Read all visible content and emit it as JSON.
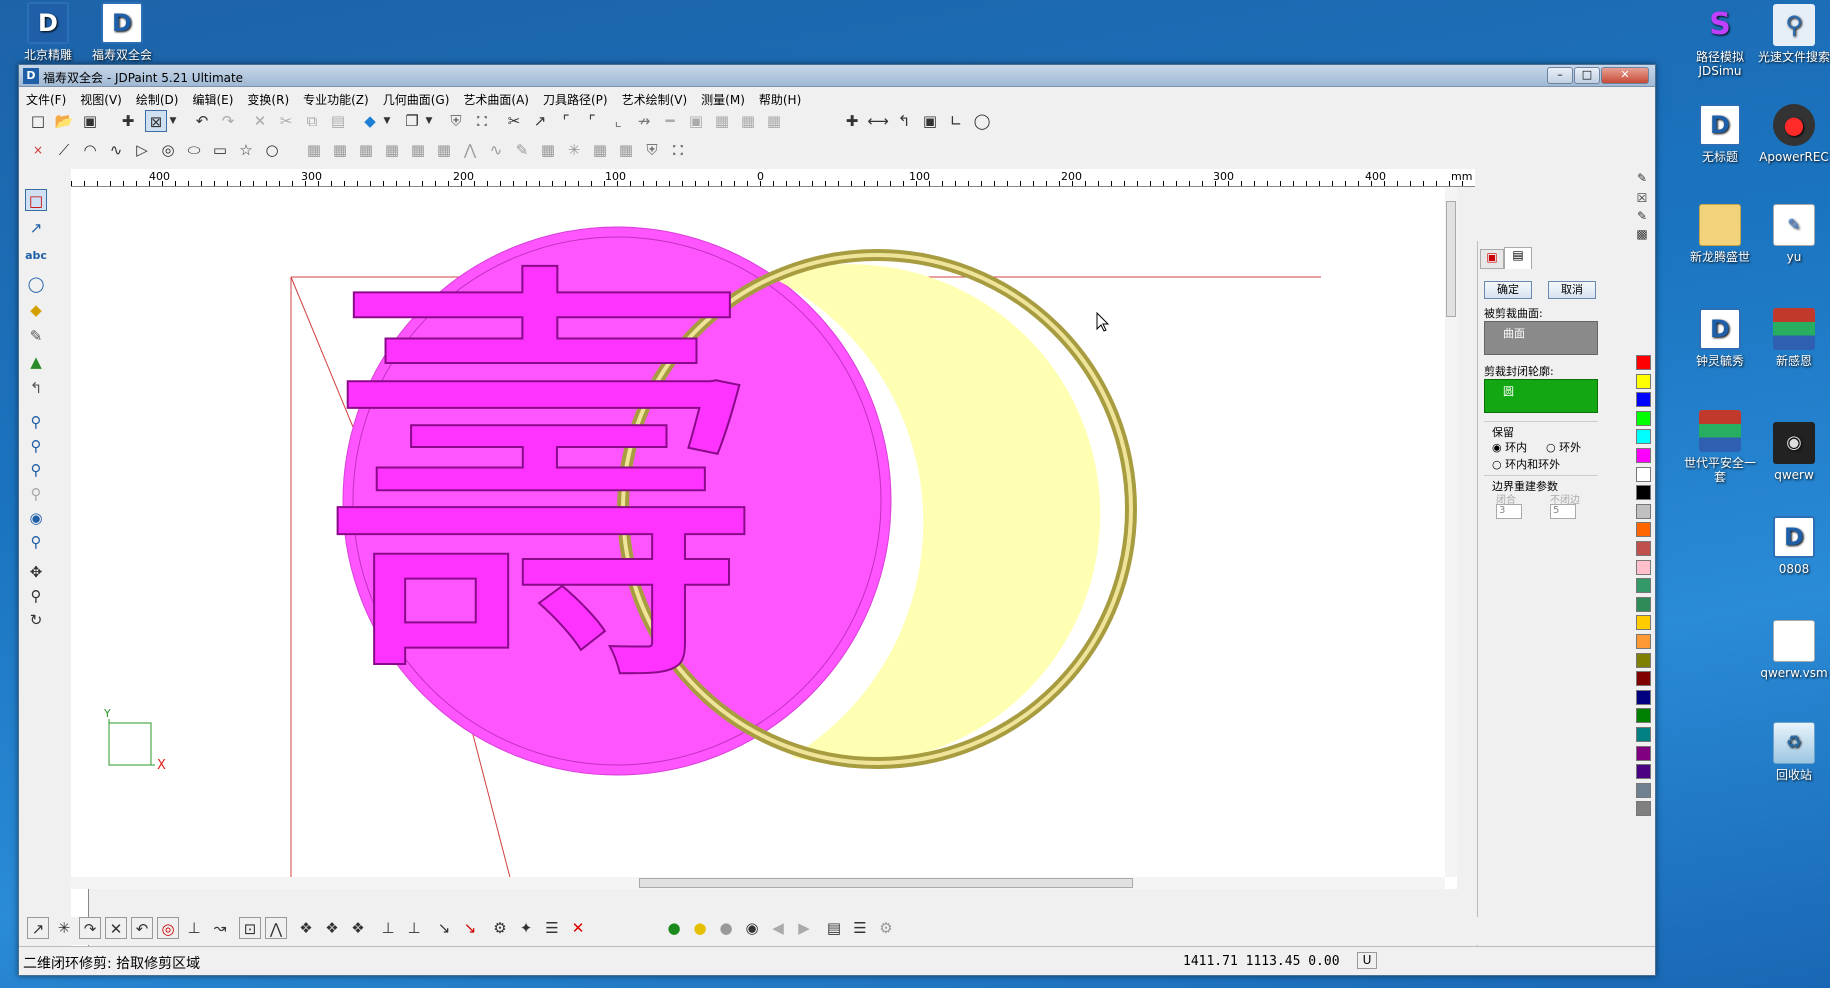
{
  "desktop": {
    "left_icons": [
      {
        "label": "北京精雕",
        "icon": "jdpaint-icon"
      },
      {
        "label": "福寿双全会",
        "icon": "jdpaint-doc-icon"
      }
    ],
    "right_icons": [
      {
        "label": "路径模拟 JDSimu",
        "icon": "jdsimu-icon"
      },
      {
        "label": "光速文件搜索",
        "icon": "search-icon"
      },
      {
        "label": "无标题",
        "icon": "jdpaint-doc-icon"
      },
      {
        "label": "ApowerREC",
        "icon": "record-icon"
      },
      {
        "label": "新龙腾盛世",
        "icon": "folder-icon"
      },
      {
        "label": "yu",
        "icon": "document-icon"
      },
      {
        "label": "钟灵毓秀",
        "icon": "jdpaint-doc-icon"
      },
      {
        "label": "新感恩",
        "icon": "winrar-icon"
      },
      {
        "label": "世代平安全一套",
        "icon": "winrar-icon"
      },
      {
        "label": "qwerw",
        "icon": "car-icon"
      },
      {
        "label": "0808",
        "icon": "jdpaint-doc-icon"
      },
      {
        "label": "qwerw.vsm",
        "icon": "file-icon"
      },
      {
        "label": "回收站",
        "icon": "recycle-bin-icon"
      }
    ]
  },
  "window": {
    "title": "福寿双全会 - JDPaint 5.21 Ultimate",
    "controls": [
      "minimize",
      "maximize",
      "close"
    ]
  },
  "menu": [
    "文件(F)",
    "视图(V)",
    "绘制(D)",
    "编辑(E)",
    "变换(R)",
    "专业功能(Z)",
    "几何曲面(G)",
    "艺术曲面(A)",
    "刀具路径(P)",
    "艺术绘制(V)",
    "测量(M)",
    "帮助(H)"
  ],
  "ruler": {
    "top_labels": [
      "400",
      "300",
      "200",
      "100",
      "0",
      "100",
      "200",
      "300",
      "400"
    ],
    "unit": "mm",
    "left_labels": [
      [
        "2",
        "0",
        "0"
      ],
      [
        "1",
        "0",
        "0"
      ],
      [
        "0"
      ],
      [
        "1",
        "0",
        "0"
      ],
      [
        "2",
        "0",
        "0"
      ]
    ]
  },
  "canvas": {
    "character": "壽",
    "axis_x": "X",
    "axis_y": "Y",
    "colors": {
      "magenta": "#ff55ff",
      "yellow": "#ffffb3",
      "ring": "#b2a84a"
    }
  },
  "panel": {
    "ok": "确定",
    "cancel": "取消",
    "trimmed_surface_label": "被剪裁曲面:",
    "trimmed_surface_item": "曲面",
    "trim_contour_label": "剪裁封闭轮廓:",
    "trim_contour_item": "圆",
    "keep_label": "保留",
    "keep_inside": "环内",
    "keep_outside": "环外",
    "keep_both": "环内和环外",
    "rebuild_label": "边界重建参数",
    "closed_label": "闭合",
    "unclosed_label": "不闭边",
    "closed_value": "3",
    "unclosed_value": "5"
  },
  "palette": [
    "#ff0000",
    "#ffff00",
    "#0000ff",
    "#00ff00",
    "#00ffff",
    "#ff00ff",
    "#ffffff",
    "#000000",
    "#c0c0c0",
    "#ff6600",
    "#c0504d",
    "#ffc0cb",
    "#339966",
    "#2e8b57",
    "#ffcc00",
    "#ff9933",
    "#808000",
    "#800000",
    "#000080",
    "#008000",
    "#008080",
    "#800080",
    "#4b0082",
    "#708090",
    "#808080"
  ],
  "status": {
    "prompt": "二维闭环修剪: 拾取修剪区域",
    "coords": "1411.71 1113.45 0.00",
    "mode": "U"
  }
}
